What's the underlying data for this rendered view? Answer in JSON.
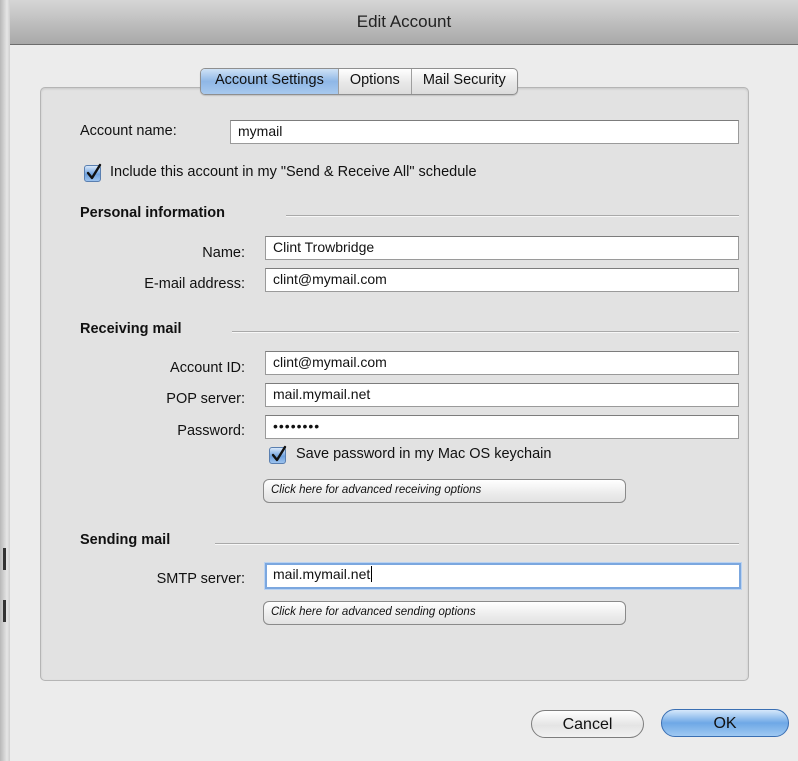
{
  "window": {
    "title": "Edit Account"
  },
  "tabs": [
    {
      "label": "Account Settings",
      "active": true
    },
    {
      "label": "Options",
      "active": false
    },
    {
      "label": "Mail Security",
      "active": false
    }
  ],
  "account": {
    "name_label": "Account name:",
    "name_value": "mymail",
    "include_label": "Include this account in my \"Send & Receive All\" schedule",
    "include_checked": true
  },
  "personal": {
    "heading": "Personal information",
    "name_label": "Name:",
    "name_value": "Clint Trowbridge",
    "email_label": "E-mail address:",
    "email_value": "clint@mymail.com"
  },
  "receiving": {
    "heading": "Receiving mail",
    "account_id_label": "Account ID:",
    "account_id_value": "clint@mymail.com",
    "pop_label": "POP server:",
    "pop_value": "mail.mymail.net",
    "password_label": "Password:",
    "password_value": "••••••••",
    "keychain_label": "Save password in my Mac OS keychain",
    "keychain_checked": true,
    "advanced_label": "Click here for advanced receiving options"
  },
  "sending": {
    "heading": "Sending mail",
    "smtp_label": "SMTP server:",
    "smtp_value": "mail.mymail.net",
    "advanced_label": "Click here for advanced sending options"
  },
  "buttons": {
    "cancel": "Cancel",
    "ok": "OK"
  },
  "colors": {
    "accent": "#6ea8e6",
    "window_bg": "#ececec",
    "panel_bg": "#e2e2e2"
  }
}
